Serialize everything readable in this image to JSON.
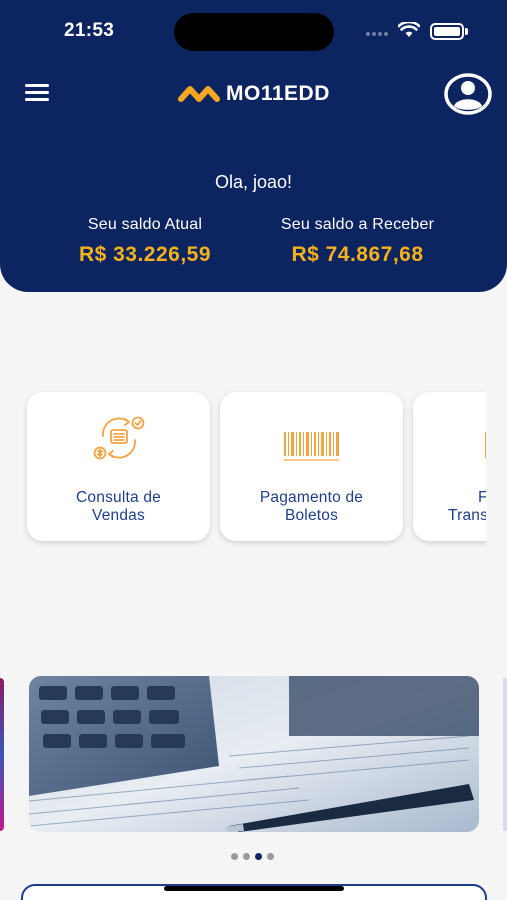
{
  "status_bar": {
    "time": "21:53"
  },
  "header": {
    "logo_text": "MO11EDD",
    "greeting": "Ola, joao!",
    "balances": [
      {
        "label": "Seu saldo Atual",
        "value": "R$ 33.226,59"
      },
      {
        "label": "Seu saldo a Receber",
        "value": "R$ 74.867,68"
      }
    ]
  },
  "services": [
    {
      "label_line1": "Consulta de",
      "label_line2": "Vendas",
      "icon": "sales-cycle-icon"
    },
    {
      "label_line1": "Pagamento de",
      "label_line2": "Boletos",
      "icon": "barcode-icon"
    },
    {
      "label_line1": "F",
      "label_line2": "Trans",
      "icon": "transfer-icon"
    }
  ],
  "carousel": {
    "page_count": 4,
    "active_index": 2
  },
  "colors": {
    "primary": "#0c2460",
    "accent": "#f5b21c",
    "link": "#1f3e8a",
    "icon_orange": "#f2a444"
  }
}
